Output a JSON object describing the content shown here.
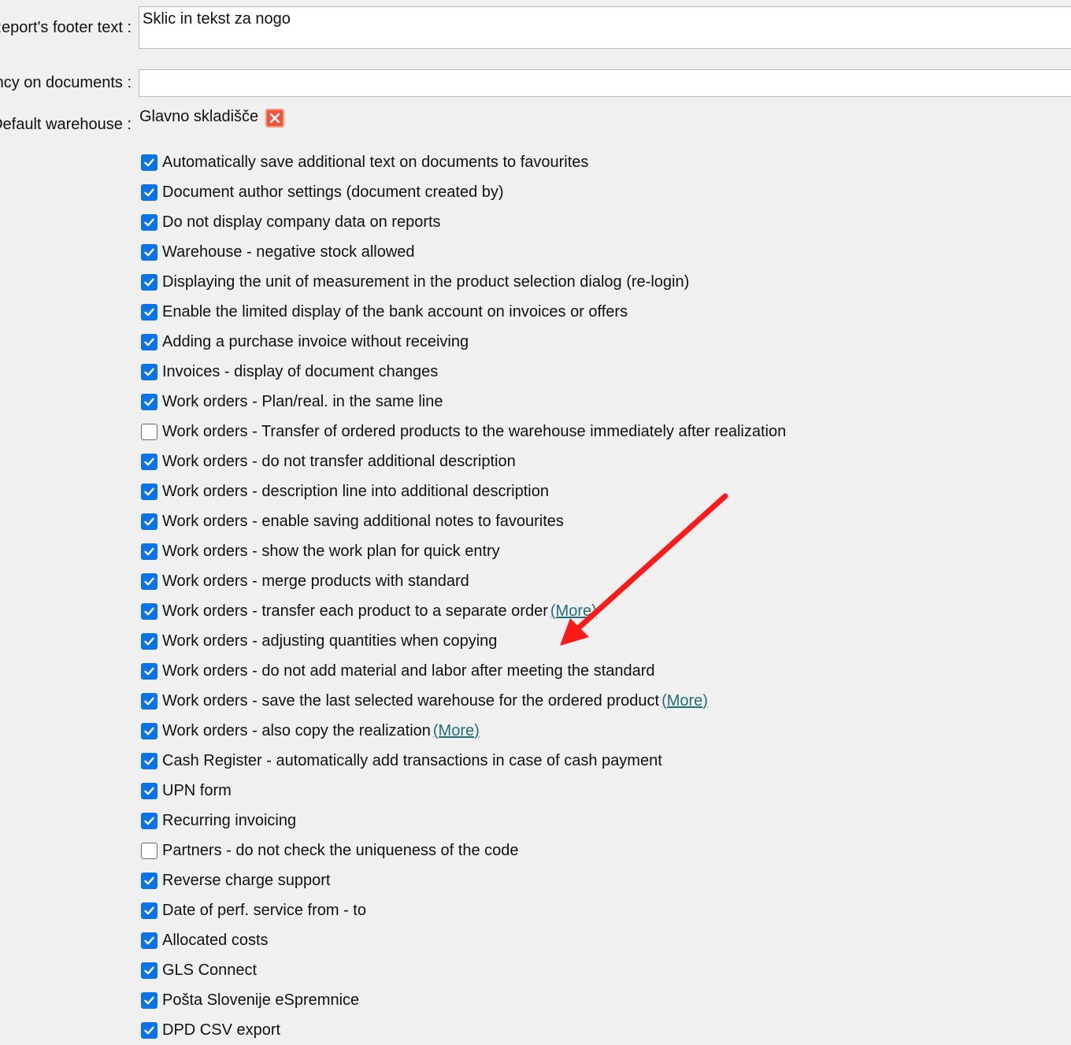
{
  "form": {
    "footer_label": "Report's footer text :",
    "footer_value": "Sklic in tekst za nogo",
    "currency_label": "Currency on documents :",
    "currency_value": "",
    "warehouse_label": "Default warehouse :",
    "warehouse_value": "Glavno skladišče",
    "remove_icon": "close-icon",
    "accent_color": "#0b73e8",
    "link_color": "#1f6f78",
    "annotation_color": "#ff1a1a"
  },
  "options": [
    {
      "label": "Automatically save additional text on documents to favourites",
      "checked": true,
      "more": ""
    },
    {
      "label": "Document author settings (document created by)",
      "checked": true,
      "more": ""
    },
    {
      "label": "Do not display company data on reports",
      "checked": true,
      "more": ""
    },
    {
      "label": "Warehouse - negative stock allowed",
      "checked": true,
      "more": ""
    },
    {
      "label": "Displaying the unit of measurement in the product selection dialog (re-login)",
      "checked": true,
      "more": ""
    },
    {
      "label": "Enable the limited display of the bank account on invoices or offers",
      "checked": true,
      "more": ""
    },
    {
      "label": "Adding a purchase invoice without receiving",
      "checked": true,
      "more": ""
    },
    {
      "label": "Invoices - display of document changes",
      "checked": true,
      "more": ""
    },
    {
      "label": "Work orders - Plan/real. in the same line",
      "checked": true,
      "more": ""
    },
    {
      "label": "Work orders - Transfer of ordered products to the warehouse immediately after realization",
      "checked": false,
      "more": ""
    },
    {
      "label": "Work orders - do not transfer additional description",
      "checked": true,
      "more": ""
    },
    {
      "label": "Work orders - description line into additional description",
      "checked": true,
      "more": ""
    },
    {
      "label": "Work orders - enable saving additional notes to favourites",
      "checked": true,
      "more": ""
    },
    {
      "label": "Work orders - show the work plan for quick entry",
      "checked": true,
      "more": ""
    },
    {
      "label": "Work orders - merge products with standard",
      "checked": true,
      "more": ""
    },
    {
      "label": "Work orders - transfer each product to a separate order",
      "checked": true,
      "more": "(More)"
    },
    {
      "label": "Work orders - adjusting quantities when copying",
      "checked": true,
      "more": ""
    },
    {
      "label": "Work orders - do not add material and labor after meeting the standard",
      "checked": true,
      "more": ""
    },
    {
      "label": "Work orders - save the last selected warehouse for the ordered product",
      "checked": true,
      "more": "(More)"
    },
    {
      "label": "Work orders - also copy the realization",
      "checked": true,
      "more": "(More)"
    },
    {
      "label": "Cash Register - automatically add transactions in case of cash payment",
      "checked": true,
      "more": ""
    },
    {
      "label": "UPN form",
      "checked": true,
      "more": ""
    },
    {
      "label": "Recurring invoicing",
      "checked": true,
      "more": ""
    },
    {
      "label": "Partners - do not check the uniqueness of the code",
      "checked": false,
      "more": ""
    },
    {
      "label": "Reverse charge support",
      "checked": true,
      "more": ""
    },
    {
      "label": "Date of perf. service from - to",
      "checked": true,
      "more": ""
    },
    {
      "label": "Allocated costs",
      "checked": true,
      "more": ""
    },
    {
      "label": "GLS Connect",
      "checked": true,
      "more": ""
    },
    {
      "label": "Pošta Slovenije eSpremnice",
      "checked": true,
      "more": ""
    },
    {
      "label": "DPD CSV export",
      "checked": true,
      "more": ""
    }
  ]
}
